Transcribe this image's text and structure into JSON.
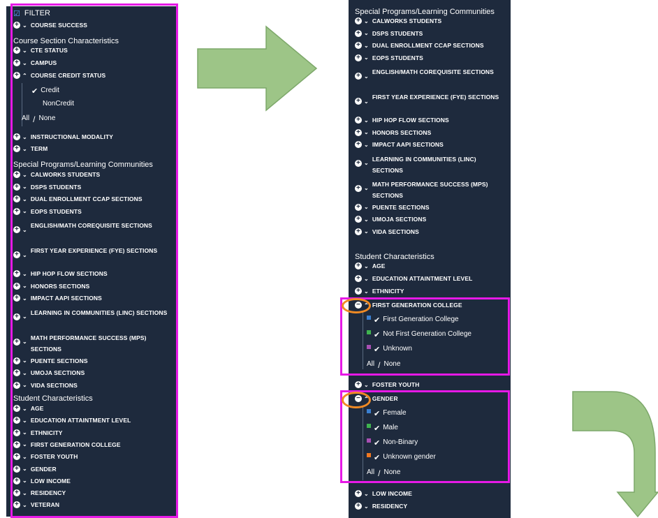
{
  "left_panel": {
    "filter_label": "FILTER",
    "course_success": "Course Success",
    "section_course": "Course Section Characteristics",
    "cte_status": "CTE Status",
    "campus": "Campus",
    "course_credit_status": "Course Credit Status",
    "credit": "Credit",
    "noncredit": "NonCredit",
    "all": "All",
    "slash": "/",
    "none": "None",
    "instructional_modality": "Instructional Modality",
    "term": "Term",
    "section_special": "Special Programs/Learning Communities",
    "special_items": [
      "CalWORKs students",
      "DSPS students",
      "Dual Enrollment CCAP sections",
      "EOPS students",
      "English/Math Corequisite Sections",
      "First Year Experience (FYE) sections",
      "Hip Hop Flow Sections",
      "Honors sections",
      "IMPACT AAPI Sections",
      "Learning in Communities (LinC) sections",
      "Math Performance Success (MPS) sections",
      "Puente sections",
      "Umoja sections",
      "VIDA sections"
    ],
    "section_student": "Student Characteristics",
    "student_items": [
      "Age",
      "Education Attaintment Level",
      "Ethnicity",
      "First Generation College",
      "Foster Youth",
      "Gender",
      "Low Income",
      "Residency",
      "Veteran"
    ]
  },
  "right_panel": {
    "section_special": "Special Programs/Learning Communities",
    "special_items": [
      "CalWORKs students",
      "DSPS students",
      "Dual Enrollment CCAP sections",
      "EOPS students",
      "English/Math Corequisite Sections",
      "First Year Experience (FYE) sections",
      "Hip Hop Flow Sections",
      "Honors sections",
      "IMPACT AAPI Sections",
      "Learning in Communities (LinC) sections",
      "Math Performance Success (MPS) sections",
      "Puente sections",
      "Umoja sections",
      "VIDA sections"
    ],
    "section_student": "Student Characteristics",
    "age": "Age",
    "education": "Education Attaintment Level",
    "ethnicity": "Ethnicity",
    "fgc": "First Generation College",
    "fgc_options": [
      "First Generation College",
      "Not First Generation College",
      "Unknown"
    ],
    "foster": "Foster Youth",
    "gender": "Gender",
    "gender_options": [
      "Female",
      "Male",
      "Non-Binary",
      "Unknown gender"
    ],
    "all": "All",
    "slash": "/",
    "none": "None",
    "low_income": "Low Income",
    "residency": "Residency"
  },
  "colors": {
    "panel_bg": "#1e2a3d",
    "highlight": "#e619e6",
    "circle": "#f08a24",
    "arrow": "#9dc587",
    "opt_blue": "#3a7fd0",
    "opt_green": "#3fb34f",
    "opt_purple": "#a84fb3",
    "opt_orange": "#f07820"
  }
}
